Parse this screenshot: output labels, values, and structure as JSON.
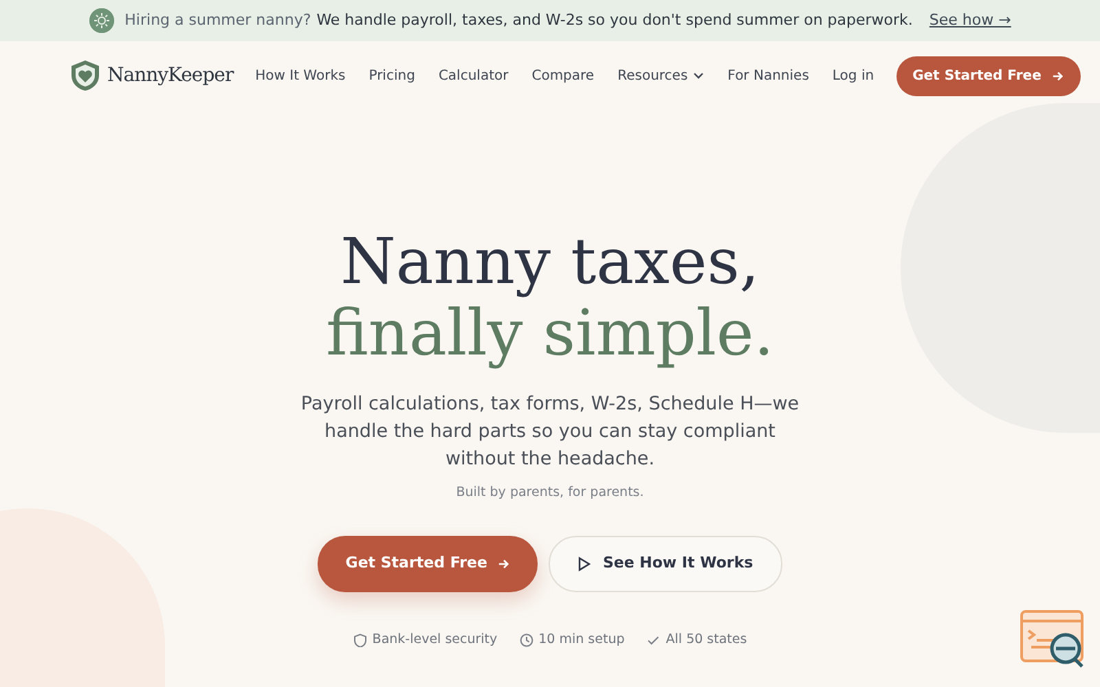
{
  "banner": {
    "lead": "Hiring a summer nanny?",
    "message": "We handle payroll, taxes, and W-2s so you don't spend summer on paperwork.",
    "link": "See how →"
  },
  "navbar": {
    "brand": "NannyKeeper",
    "links": [
      {
        "label": "How It Works",
        "kind": "link"
      },
      {
        "label": "Pricing",
        "kind": "link"
      },
      {
        "label": "Calculator",
        "kind": "link"
      },
      {
        "label": "Compare",
        "kind": "link"
      },
      {
        "label": "Resources",
        "kind": "dropdown"
      },
      {
        "label": "For Nannies",
        "kind": "link"
      },
      {
        "label": "Log in",
        "kind": "link"
      }
    ],
    "cta": "Get Started Free"
  },
  "hero": {
    "title_line_1": "Nanny taxes,",
    "title_line_2": "finally simple.",
    "description": "Payroll calculations, tax forms, W-2s, Schedule H—we handle the hard parts so you can stay compliant without the headache.",
    "tagline": "Built by parents, for parents.",
    "primary_button": "Get Started Free",
    "secondary_button": "See How It Works",
    "features": [
      {
        "kind": "security",
        "label": "Bank-level security"
      },
      {
        "kind": "time",
        "label": "10 min setup"
      },
      {
        "kind": "coverage",
        "label": "All 50 states"
      }
    ]
  }
}
